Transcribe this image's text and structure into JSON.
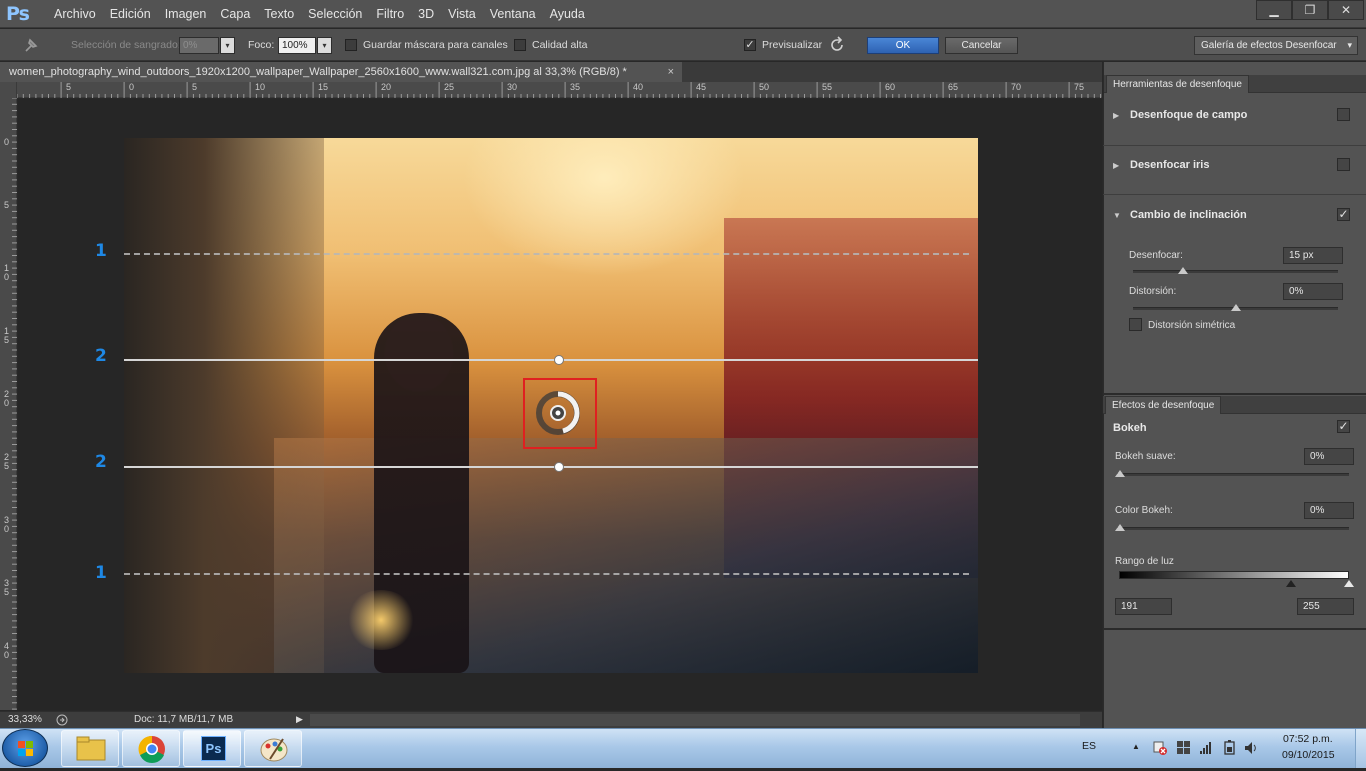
{
  "app": {
    "logo": "Ps",
    "menu": [
      "Archivo",
      "Edición",
      "Imagen",
      "Capa",
      "Texto",
      "Selección",
      "Filtro",
      "3D",
      "Vista",
      "Ventana",
      "Ayuda"
    ],
    "window_controls": {
      "minimize": "▁",
      "restore": "❐",
      "close": "✕"
    }
  },
  "options_bar": {
    "seleccion_sangrado_label": "Selección de sangrado:",
    "seleccion_sangrado_value": "0%",
    "foco_label": "Foco:",
    "foco_value": "100%",
    "guardar_mascara_label": "Guardar máscara para canales",
    "calidad_alta_label": "Calidad alta",
    "previsualizar_label": "Previsualizar",
    "previsualizar_checked": "✓",
    "ok_label": "OK",
    "cancel_label": "Cancelar",
    "gallery_label": "Galería de efectos Desenfocar",
    "dropdown_arrow": "▾"
  },
  "document": {
    "tab_title": "women_photography_wind_outdoors_1920x1200_wallpaper_Wallpaper_2560x1600_www.wall321.com.jpg al 33,3% (RGB/8) *",
    "tab_close": "×",
    "ruler_top": [
      "5",
      "0",
      "5",
      "10",
      "15",
      "20",
      "25",
      "30",
      "35",
      "40",
      "45",
      "50",
      "55",
      "60",
      "65",
      "70",
      "75"
    ],
    "ruler_left": [
      "0",
      "5",
      "1 0",
      "1 5",
      "2 0",
      "2 5",
      "3 0",
      "3 5",
      "4 0"
    ]
  },
  "overlay": {
    "zone_labels": [
      "1",
      "2",
      "2",
      "1"
    ]
  },
  "status_bar": {
    "zoom": "33,33%",
    "doc_info": "Doc: 11,7 MB/11,7 MB",
    "arrow": "▶"
  },
  "blur_tools_panel": {
    "tab": "Herramientas de desenfoque",
    "field_blur": {
      "label": "Desenfoque de campo",
      "checked": ""
    },
    "iris_blur": {
      "label": "Desenfocar iris",
      "checked": ""
    },
    "tilt_shift": {
      "label": "Cambio de inclinación",
      "checked": "✓",
      "desenfocar_label": "Desenfocar:",
      "desenfocar_value": "15 px",
      "distorsion_label": "Distorsión:",
      "distorsion_value": "0%",
      "simetrica_label": "Distorsión simétrica",
      "simetrica_checked": ""
    },
    "collapsed_arrow": "▶",
    "expanded_arrow": "▼"
  },
  "blur_effects_panel": {
    "tab": "Efectos de desenfoque",
    "bokeh_label": "Bokeh",
    "bokeh_checked": "✓",
    "bokeh_suave_label": "Bokeh suave:",
    "bokeh_suave_value": "0%",
    "color_bokeh_label": "Color Bokeh:",
    "color_bokeh_value": "0%",
    "rango_luz_label": "Rango de luz",
    "rango_luz_min": "191",
    "rango_luz_max": "255"
  },
  "taskbar": {
    "ps_label": "Ps",
    "language": "ES",
    "time": "07:52 p.m.",
    "date": "09/10/2015",
    "tray_up_arrow": "▲"
  },
  "colors": {
    "accent_blue": "#1e88e5",
    "highlight_red": "#e02020",
    "ok_button": "#2d62b3"
  }
}
